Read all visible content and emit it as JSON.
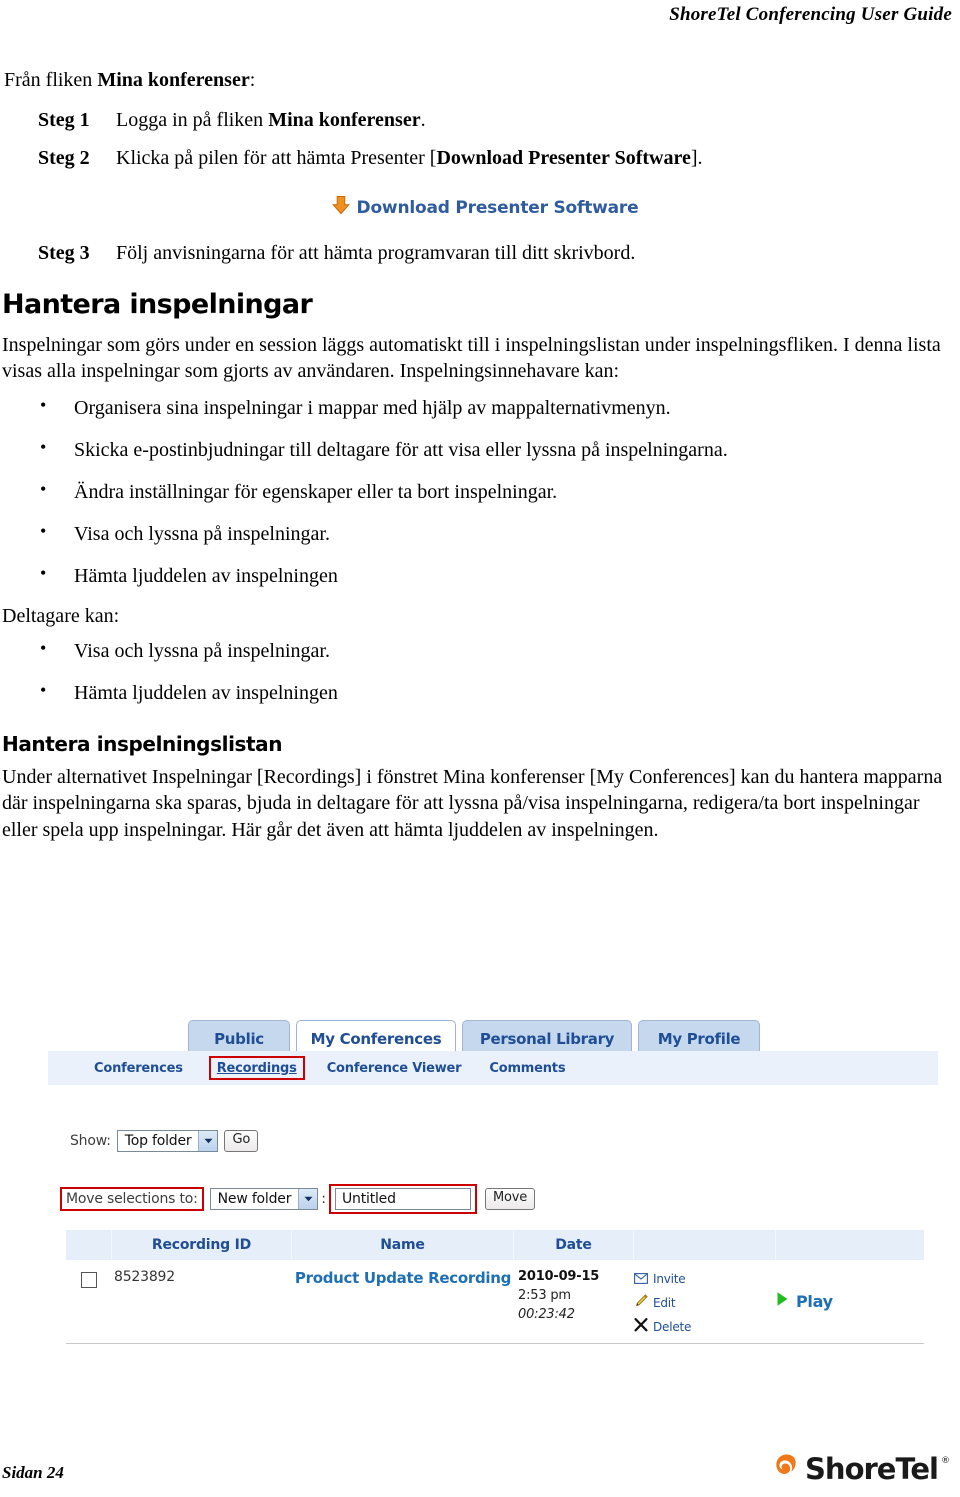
{
  "header": {
    "running_title": "ShoreTel Conferencing User Guide"
  },
  "doc": {
    "intro": "Från fliken Mina konferenser:",
    "intro_bold": "Mina konferenser",
    "steps": [
      {
        "label": "Steg 1",
        "text_before": "Logga in på fliken ",
        "bold": "Mina konferenser",
        "text_after": "."
      },
      {
        "label": "Steg 2",
        "text_before": "Klicka på pilen för att hämta Presenter [",
        "bold": "Download Presenter Software",
        "text_after": "]."
      },
      {
        "label": "Steg 3",
        "text_before": "Följ anvisningarna för att hämta programvaran till ditt skrivbord.",
        "bold": "",
        "text_after": ""
      }
    ],
    "download_button": {
      "label": "Download Presenter Software",
      "icon": "download-arrow-icon",
      "text_color": "#2F5C9E",
      "arrow_color": "#F09020"
    },
    "section1": {
      "heading": "Hantera inspelningar",
      "paragraph": "Inspelningar som görs under en session läggs automatiskt till i inspelningslistan under inspelningsfliken. I denna lista visas alla inspelningar som gjorts av användaren. Inspelningsinnehavare kan:",
      "bullets": [
        "Organisera sina inspelningar i mappar med hjälp av mappalternativmenyn.",
        "Skicka e-postinbjudningar till deltagare för att visa eller lyssna på inspelningarna.",
        "Ändra inställningar för egenskaper eller ta bort inspelningar.",
        "Visa och lyssna på inspelningar.",
        "Hämta ljuddelen av inspelningen"
      ],
      "lead_in": "Deltagare kan:",
      "bullets2": [
        "Visa och lyssna på inspelningar.",
        "Hämta ljuddelen av inspelningen"
      ]
    },
    "section2": {
      "heading": "Hantera inspelningslistan",
      "paragraph": "Under alternativet Inspelningar [Recordings] i fönstret Mina konferenser [My Conferences] kan du hantera mapparna där inspelningarna ska sparas, bjuda in deltagare för att lyssna på/visa inspelningarna, redigera/ta bort inspelningar eller spela upp inspelningar. Här går det även att hämta ljuddelen av inspelningen."
    }
  },
  "screenshot": {
    "tabs": [
      {
        "label": "Public",
        "active": false
      },
      {
        "label": "My Conferences",
        "active": true
      },
      {
        "label": "Personal Library",
        "active": false
      },
      {
        "label": "My Profile",
        "active": false
      }
    ],
    "subtabs": [
      {
        "label": "Conferences",
        "highlighted": false
      },
      {
        "label": "Recordings",
        "highlighted": true
      },
      {
        "label": "Conference Viewer",
        "highlighted": false
      },
      {
        "label": "Comments",
        "highlighted": false
      }
    ],
    "show_row": {
      "label": "Show:",
      "select_value": "Top folder",
      "go_button": "Go"
    },
    "move_row": {
      "label": "Move selections to:",
      "select_value": "New folder",
      "separator": ":",
      "input_value": "Untitled",
      "input_placeholder": "Untitled",
      "move_button": "Move"
    },
    "table": {
      "columns": [
        "",
        "Recording ID",
        "Name",
        "Date",
        "",
        ""
      ],
      "rows": [
        {
          "checked": false,
          "recording_id": "8523892",
          "name": "Product Update Recording",
          "date": "2010-09-15",
          "time": "2:53 pm",
          "duration": "00:23:42",
          "actions": [
            {
              "label": "Invite",
              "icon": "envelope-icon"
            },
            {
              "label": "Edit",
              "icon": "pencil-icon"
            },
            {
              "label": "Delete",
              "icon": "x-icon"
            }
          ],
          "play_label": "Play",
          "play_icon": "play-triangle-icon"
        }
      ]
    },
    "colors": {
      "tab_inactive": "#c5d8ee",
      "tab_active": "#ffffff",
      "subbar": "#eaf1fb",
      "highlight_red": "#CC0000",
      "link_blue": "#1F4E94",
      "table_header": "#e6eefa",
      "play_green": "#22BB22"
    }
  },
  "footer": {
    "page_label": "Sidan 24",
    "logo_text": "ShoreTel",
    "logo_registered": "®",
    "logo_icon": "shoretel-swirl-icon",
    "logo_color": "#F07818"
  }
}
